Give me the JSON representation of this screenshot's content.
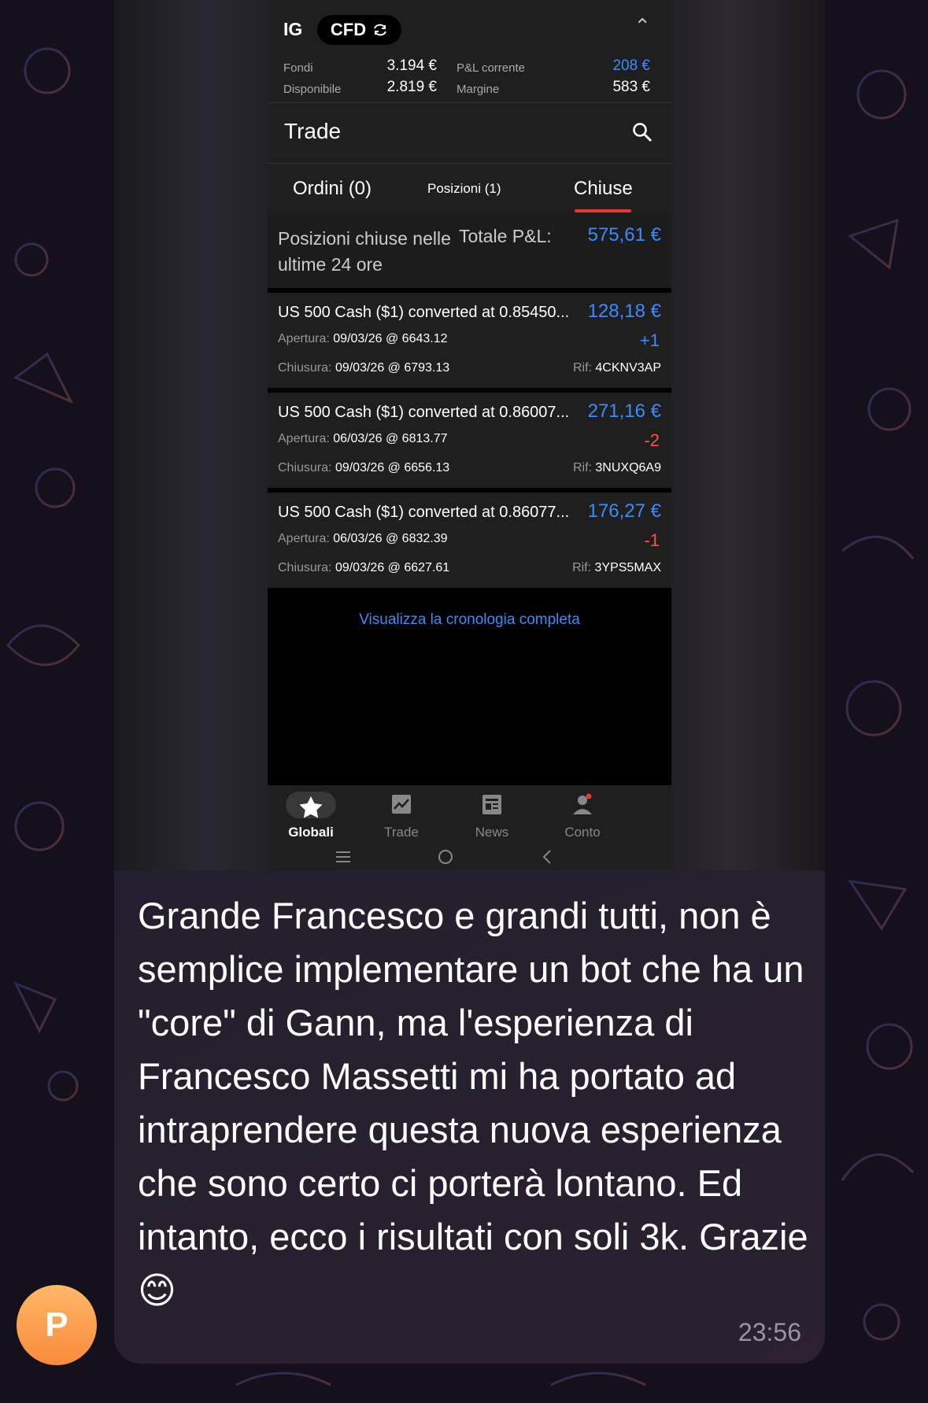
{
  "app": {
    "broker": "IG",
    "account_type": "CFD",
    "stats": [
      {
        "label": "Fondi",
        "value": "3.194 €"
      },
      {
        "label": "Disponibile",
        "value": "2.819 €"
      },
      {
        "label": "P&L corrente",
        "value": "208 €"
      },
      {
        "label": "Margine",
        "value": "583 €"
      }
    ],
    "page_title": "Trade",
    "tabs": [
      {
        "label": "Ordini (0)"
      },
      {
        "label": "Posizioni (1)"
      },
      {
        "label": "Chiuse",
        "active": true
      }
    ],
    "summary": {
      "label": "Posizioni chiuse nelle ultime 24 ore",
      "total_label": "Totale P&L:",
      "total_value": "575,61 €"
    },
    "positions": [
      {
        "name": "US 500 Cash ($1) converted at 0.85450...",
        "pl": "128,18 €",
        "direction": "+1",
        "open_label": "Apertura:",
        "open_value": "09/03/26 @ 6643.12",
        "close_label": "Chiusura:",
        "close_value": "09/03/26 @ 6793.13",
        "ref_label": "Rif:",
        "ref_value": "4CKNV3AP"
      },
      {
        "name": "US 500 Cash ($1) converted at 0.86007...",
        "pl": "271,16 €",
        "direction": "-2",
        "open_label": "Apertura:",
        "open_value": "06/03/26 @ 6813.77",
        "close_label": "Chiusura:",
        "close_value": "09/03/26 @ 6656.13",
        "ref_label": "Rif:",
        "ref_value": "3NUXQ6A9"
      },
      {
        "name": "US 500 Cash ($1) converted at 0.86077...",
        "pl": "176,27 €",
        "direction": "-1",
        "open_label": "Apertura:",
        "open_value": "06/03/26 @ 6832.39",
        "close_label": "Chiusura:",
        "close_value": "09/03/26 @ 6627.61",
        "ref_label": "Rif:",
        "ref_value": "3YPS5MAX"
      }
    ],
    "history_link": "Visualizza la cronologia completa",
    "bottom_nav": [
      {
        "label": "Globali",
        "icon": "star-icon",
        "active": true
      },
      {
        "label": "Trade",
        "icon": "chart-icon"
      },
      {
        "label": "News",
        "icon": "newspaper-icon"
      },
      {
        "label": "Conto",
        "icon": "person-icon"
      }
    ]
  },
  "message": {
    "text": "Grande Francesco e grandi tutti, non è semplice implementare un bot che ha un \"core\" di Gann, ma l'esperienza di Francesco Massetti mi ha portato ad intraprendere questa nuova esperienza che sono certo ci porterà lontano. Ed intanto, ecco i risultati con soli 3k. Grazie😊",
    "time": "23:56"
  },
  "sender": {
    "avatar_letter": "P"
  },
  "colors": {
    "profit": "#3d8bfd",
    "loss": "#ff5048",
    "accent": "#e53935",
    "avatar": "#f98a3a"
  }
}
